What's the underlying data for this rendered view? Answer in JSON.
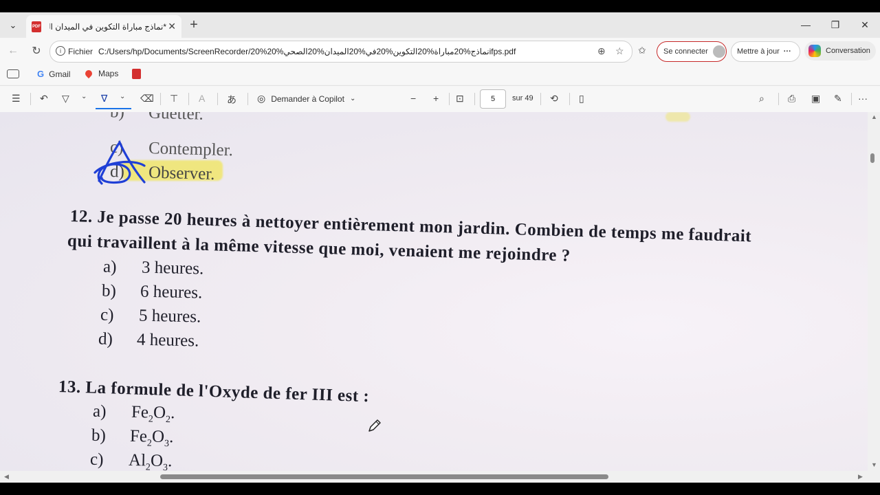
{
  "tabs": [
    {
      "title": "*نماذج مباراة التكوين في الميدان الصـ",
      "close": "✕"
    }
  ],
  "new_tab": "+",
  "window_controls": {
    "minimize": "—",
    "restore": "❐",
    "close": "✕"
  },
  "address_bar": {
    "scheme_label": "Fichier",
    "url": "C:/Users/hp/Documents/ScreenRecorder/20%نماذج%20مباراة%20التكوين%20في%20الميدان%20الصحي%20ifps.pdf"
  },
  "signin_label": "Se connecter",
  "update_label": "Mettre à jour",
  "more_label": "···",
  "copilot_label": "Conversation",
  "bookmarks": [
    {
      "label": "Gmail"
    },
    {
      "label": "Maps"
    }
  ],
  "pdf_toolbar": {
    "ask_copilot_label": "Demander à Copilot",
    "current_page": "5",
    "total_pages": "sur 49"
  },
  "document": {
    "prev_options": [
      {
        "label": "b)",
        "text": "Guetter."
      },
      {
        "label": "c)",
        "text": "Contempler."
      },
      {
        "label": "d)",
        "text": "Observer."
      }
    ],
    "q12": {
      "line1": "12. Je passe 20 heures à nettoyer entièrement mon jardin. Combien de temps me faudrait",
      "line2": "qui travaillent à la même vitesse que moi, venaient me rejoindre ?",
      "options": [
        {
          "label": "a)",
          "text": "3 heures."
        },
        {
          "label": "b)",
          "text": "6 heures."
        },
        {
          "label": "c)",
          "text": "5 heures."
        },
        {
          "label": "d)",
          "text": "4 heures."
        }
      ]
    },
    "q13": {
      "question": "13. La formule de l'Oxyde de fer III est :",
      "options": [
        {
          "label": "a)",
          "base": "Fe",
          "sub1": "2",
          "mid": "O",
          "sub2": "2",
          "end": "."
        },
        {
          "label": "b)",
          "base": "Fe",
          "sub1": "2",
          "mid": "O",
          "sub2": "3",
          "end": "."
        },
        {
          "label": "c)",
          "base": "Al",
          "sub1": "2",
          "mid": "O",
          "sub2": "3",
          "end": "."
        }
      ]
    }
  },
  "colors": {
    "highlight": "#f0e65a",
    "ink_annotation": "#1f3fd6",
    "signin_border": "#c62828"
  }
}
